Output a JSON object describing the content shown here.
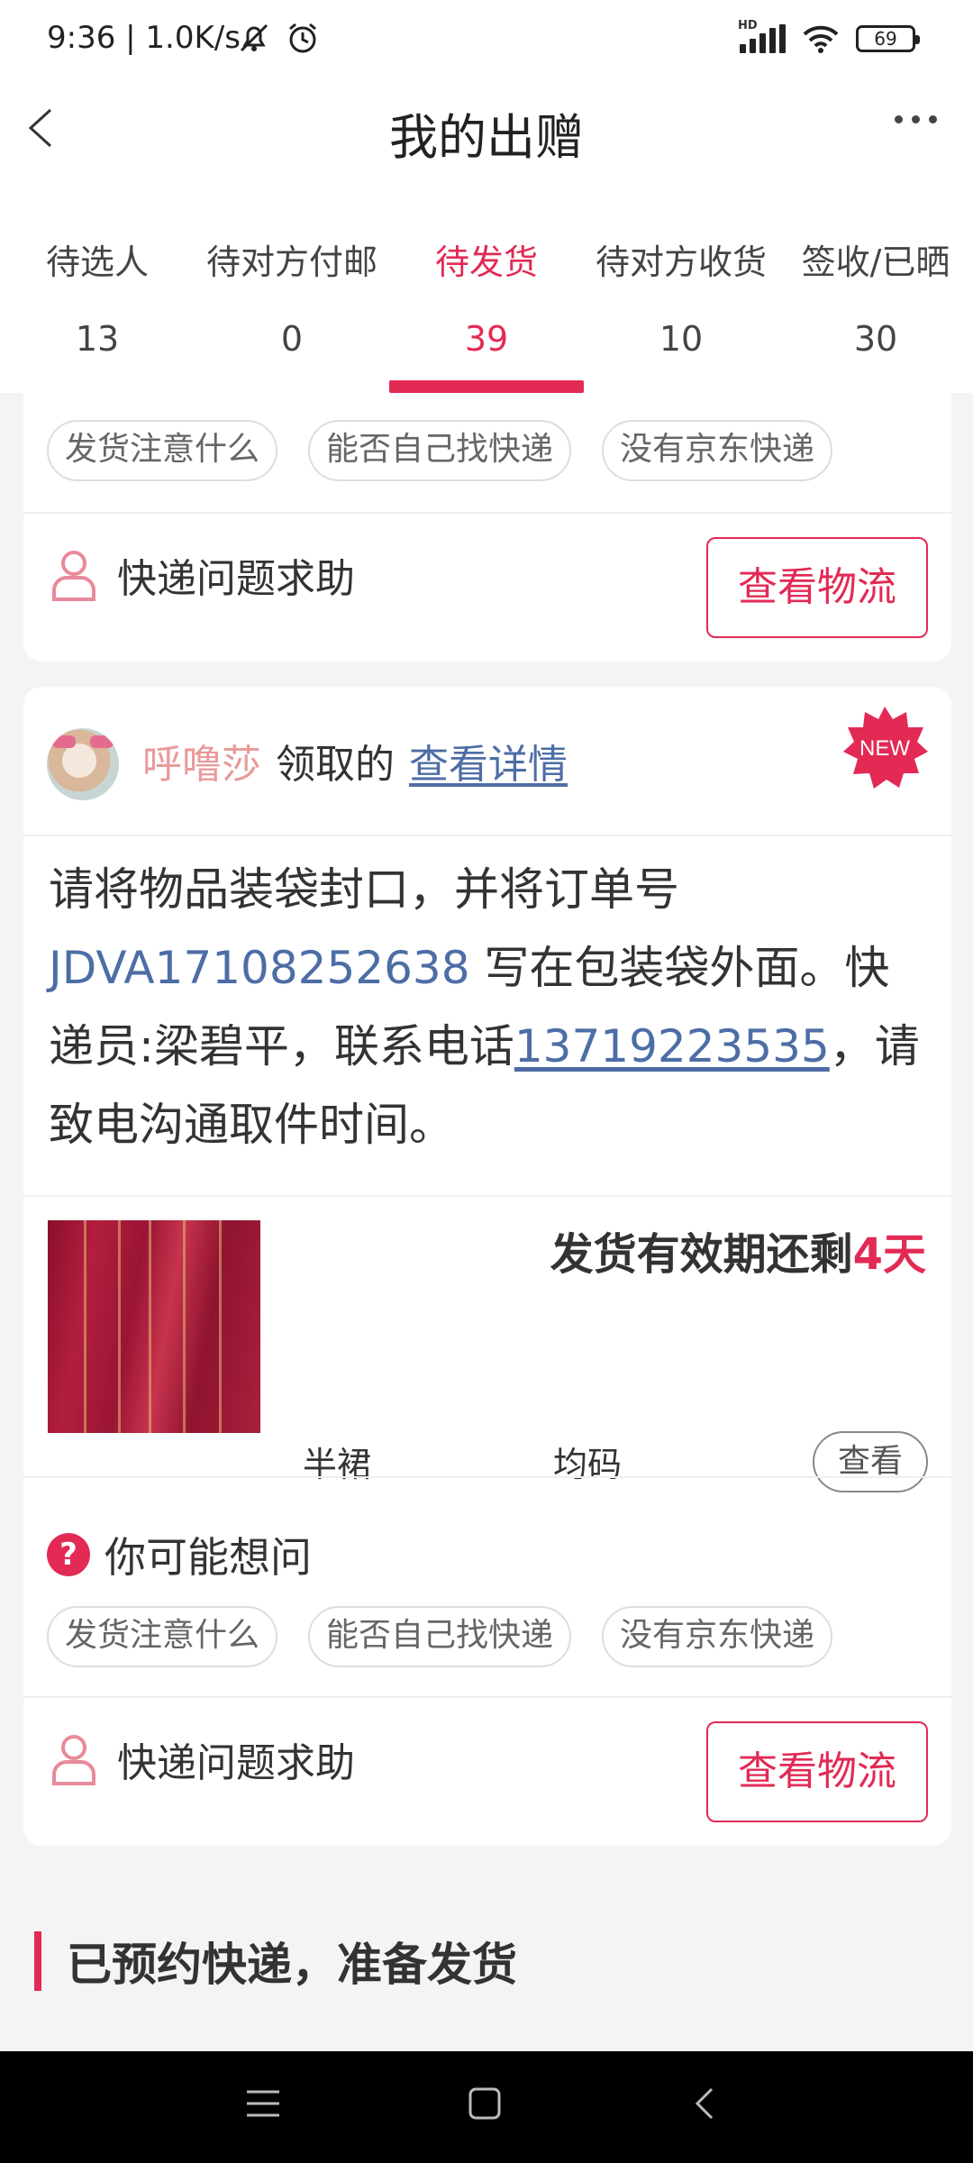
{
  "status_bar": {
    "time": "9:36 | 1.0K/s",
    "network_badge": "HD",
    "battery": "69"
  },
  "header": {
    "title": "我的出赠"
  },
  "tabs": [
    {
      "label": "待选人",
      "count": "13"
    },
    {
      "label": "待对方付邮",
      "count": "0"
    },
    {
      "label": "待发货",
      "count": "39"
    },
    {
      "label": "待对方收货",
      "count": "10"
    },
    {
      "label": "签收/已晒",
      "count": "30"
    }
  ],
  "active_tab_index": 2,
  "card1": {
    "chips": [
      "发货注意什么",
      "能否自己找快递",
      "没有京东快递"
    ],
    "help_label": "快递问题求助",
    "logistics_button": "查看物流"
  },
  "card2": {
    "user_name": "呼噜莎",
    "claim_text": "领取的",
    "detail_link": "查看详情",
    "new_badge": "NEW",
    "instruction": {
      "part1": "请将物品装袋封口，并将订单号 ",
      "order_no": "JDVA17108252638",
      "part2": " 写在包装袋外面。快递员:梁碧平，联系电话",
      "phone": "13719223535",
      "part3": "，请致电沟通取件时间。"
    },
    "deadline_prefix": "发货有效期还剩",
    "deadline_days": "4天",
    "goods_name": "半裙",
    "goods_size": "均码",
    "view_button": "查看",
    "ask_title": "你可能想问",
    "ask_icon": "?",
    "chips": [
      "发货注意什么",
      "能否自己找快递",
      "没有京东快递"
    ],
    "help_label": "快递问题求助",
    "logistics_button": "查看物流"
  },
  "section_title": "已预约快递，准备发货",
  "colors": {
    "accent": "#e22a55",
    "link": "#4d6da5",
    "username": "#e99a9a"
  }
}
